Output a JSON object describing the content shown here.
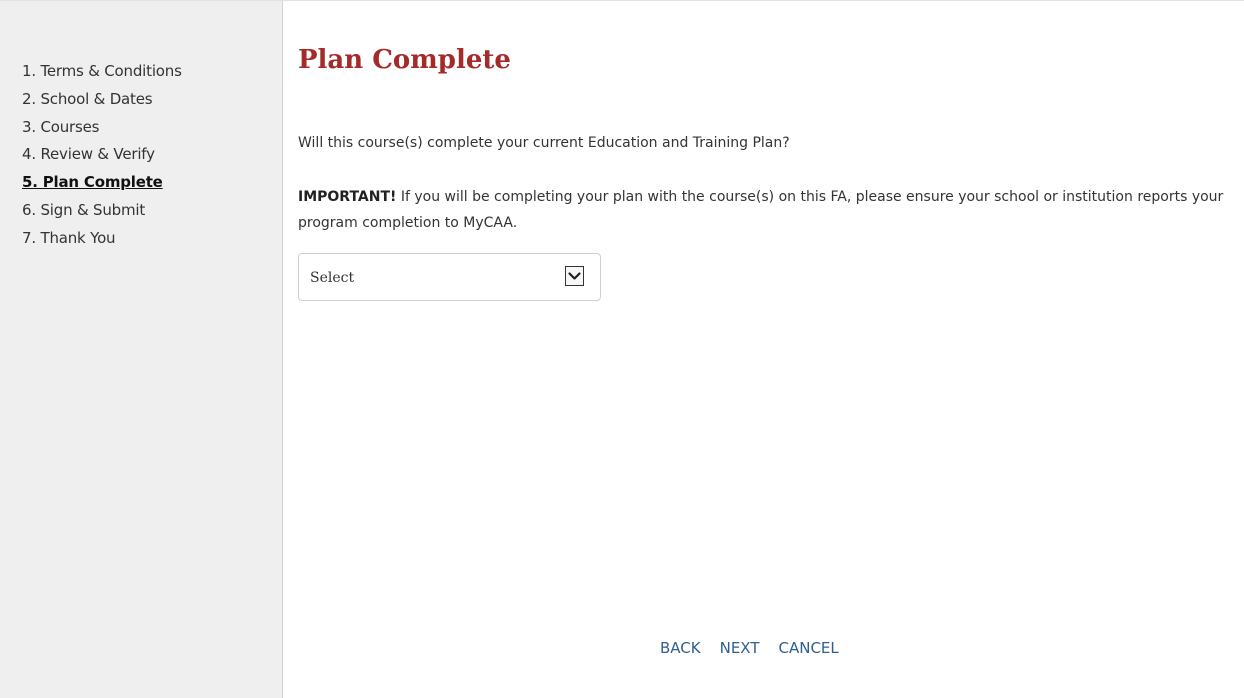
{
  "sidebar": {
    "steps": [
      {
        "label": "1. Terms & Conditions"
      },
      {
        "label": "2. School & Dates"
      },
      {
        "label": "3. Courses"
      },
      {
        "label": "4. Review & Verify"
      },
      {
        "label": "5. Plan Complete",
        "active": true
      },
      {
        "label": "6. Sign & Submit"
      },
      {
        "label": "7. Thank You"
      }
    ]
  },
  "main": {
    "title": "Plan Complete",
    "question": "Will this course(s) complete your current Education and Training Plan?",
    "important_label": "IMPORTANT!",
    "important_text": " If you will be completing your plan with the course(s) on this FA, please ensure your school or institution reports your program completion to MyCAA.",
    "select": {
      "value": "Select",
      "icon": "chevron-down-icon"
    }
  },
  "nav": {
    "back": "BACK",
    "next": "NEXT",
    "cancel": "CANCEL"
  },
  "colors": {
    "title": "#a52a2a",
    "link": "#2f5f8f",
    "sidebar_bg": "#efefef"
  }
}
